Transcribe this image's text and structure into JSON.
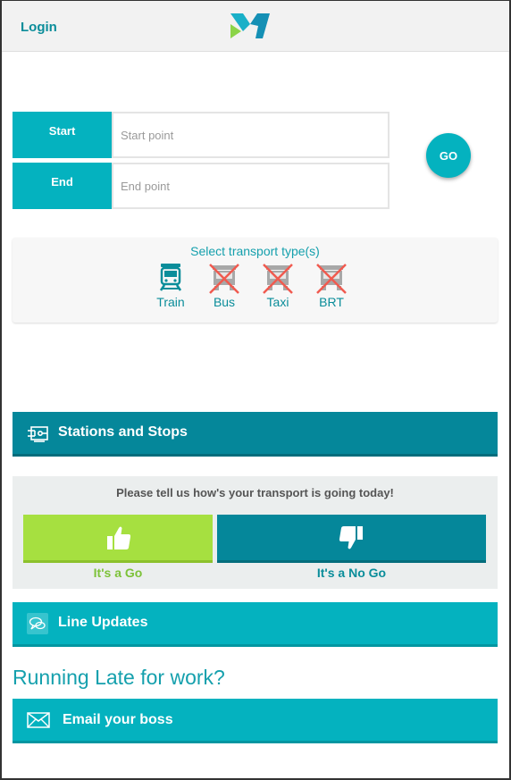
{
  "header": {
    "login_label": "Login",
    "logo_icon": "m-logo-icon"
  },
  "route": {
    "start_label": "Start",
    "start_placeholder": "Start point",
    "end_label": "End",
    "end_placeholder": "End point",
    "go_label": "GO"
  },
  "transport": {
    "title": "Select transport type(s)",
    "options": [
      {
        "label": "Train",
        "icon": "train-icon",
        "selected": true
      },
      {
        "label": "Bus",
        "icon": "bus-icon",
        "selected": false
      },
      {
        "label": "Taxi",
        "icon": "taxi-icon",
        "selected": false
      },
      {
        "label": "BRT",
        "icon": "brt-icon",
        "selected": false
      }
    ]
  },
  "stations": {
    "label": "Stations and Stops",
    "icon": "station-icon"
  },
  "feedback": {
    "question": "Please tell us how's your transport is going today!",
    "go_caption": "It's a Go",
    "nogo_caption": "It's a No Go"
  },
  "line_updates": {
    "label": "Line Updates",
    "icon": "chat-bubbles-icon"
  },
  "late": {
    "heading": "Running Late for work?",
    "email_label": "Email your boss",
    "email_icon": "envelope-icon"
  },
  "colors": {
    "teal": "#04b2bf",
    "dark_teal": "#05879a",
    "lime": "#a6e040",
    "cross": "#f05a4f"
  }
}
